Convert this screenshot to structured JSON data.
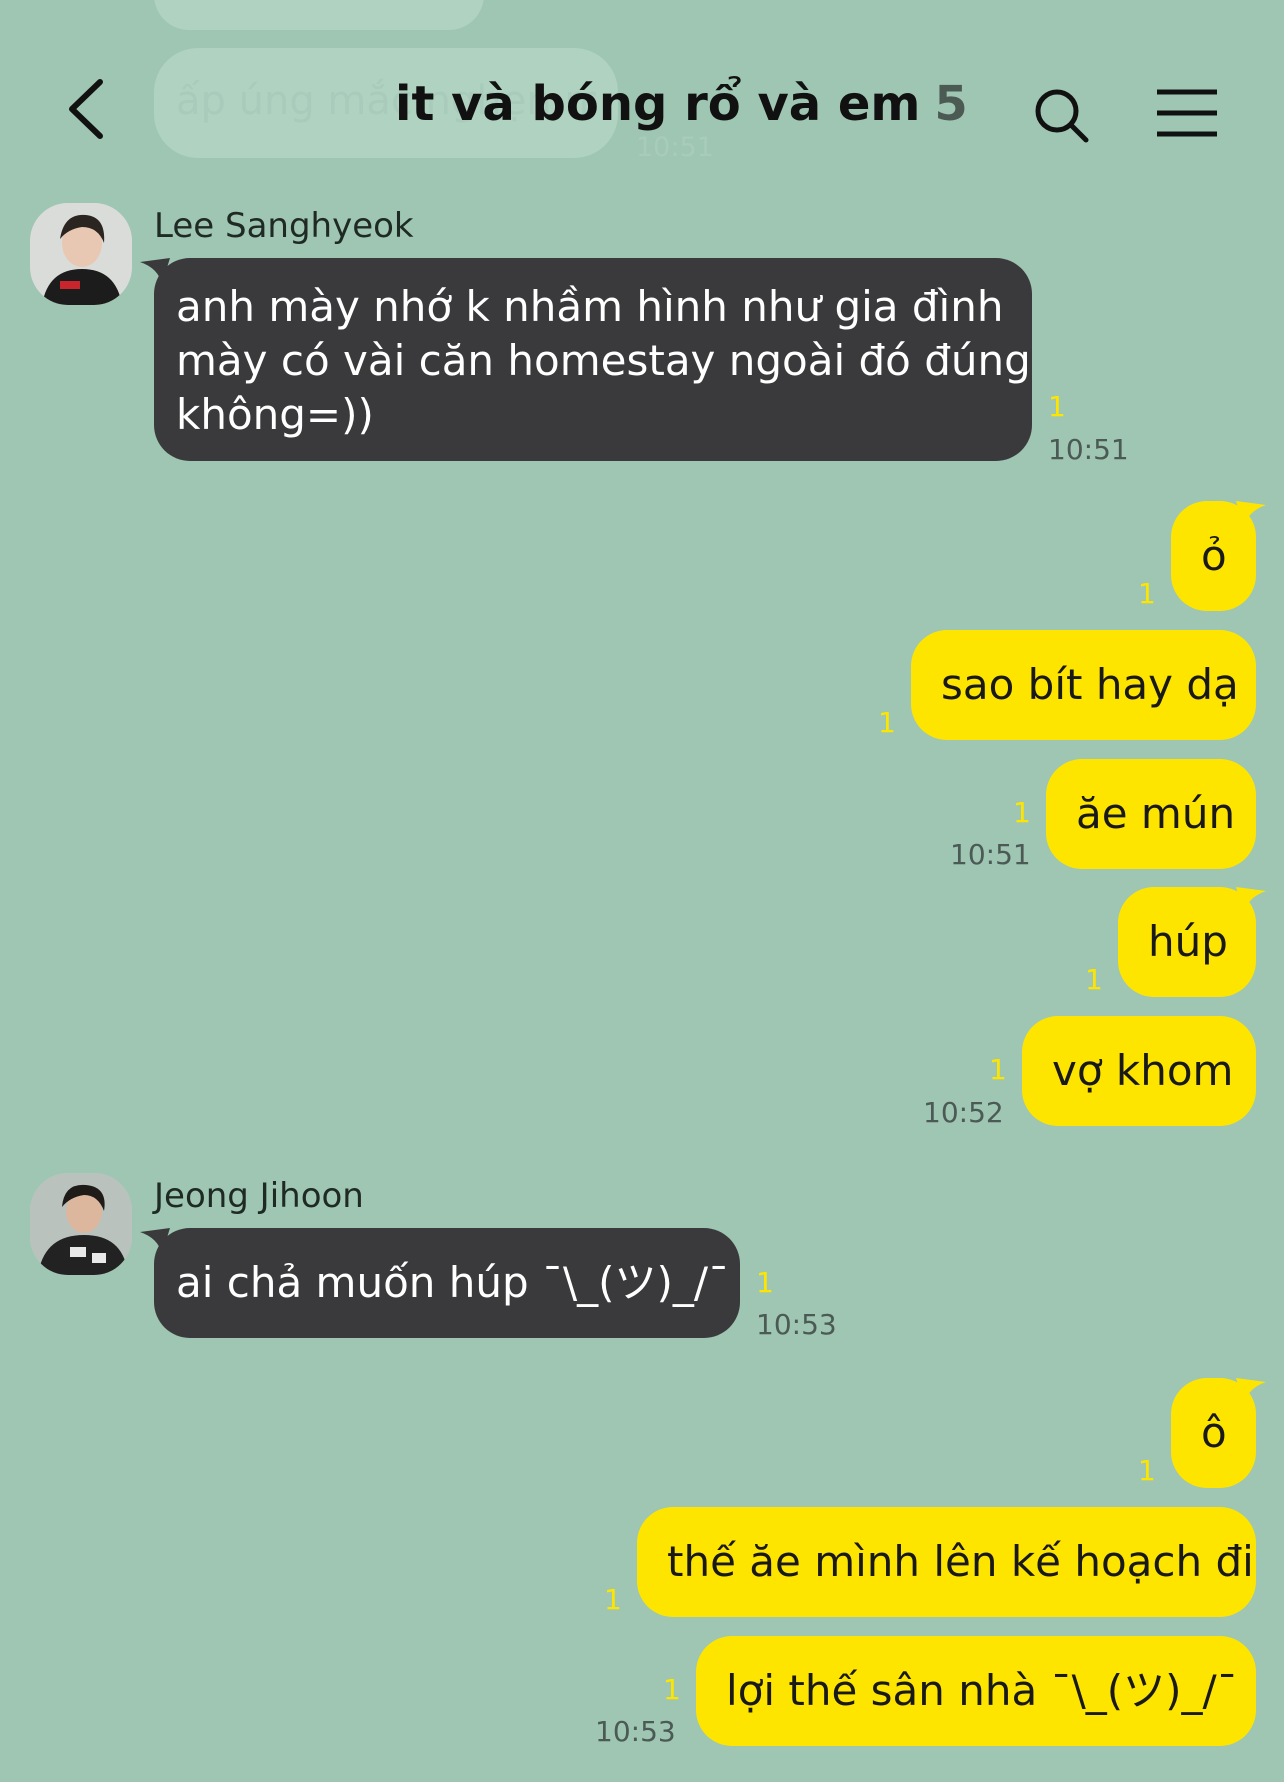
{
  "header": {
    "title": "it và bóng rổ và em",
    "member_count": "5"
  },
  "ghost": {
    "text": "ấp úng mắc nghẹn mãi...",
    "time": "10:51"
  },
  "colors": {
    "background": "#9ec6b3",
    "outgoing_bubble": "#fee500",
    "incoming_bubble": "#3a3a3c",
    "unread_count": "#fee500"
  },
  "messages": {
    "m1": {
      "sender": "Lee Sanghyeok",
      "lines": [
        "anh mày nhớ k nhầm hình như gia đình",
        "mày có vài căn homestay ngoài đó đúng",
        "không=))"
      ],
      "unread": "1",
      "time": "10:51"
    },
    "m2": {
      "text": "ỏ",
      "unread": "1"
    },
    "m3": {
      "text": "sao bít hay dạ",
      "unread": "1"
    },
    "m4": {
      "text": "ăe mún",
      "unread": "1",
      "time": "10:51"
    },
    "m5": {
      "text": "húp",
      "unread": "1"
    },
    "m6": {
      "text": "vợ khom",
      "unread": "1",
      "time": "10:52"
    },
    "m7": {
      "sender": "Jeong Jihoon",
      "text": "ai chả muốn húp ¯\\_(ツ)_/¯",
      "unread": "1",
      "time": "10:53"
    },
    "m8": {
      "text": "ô",
      "unread": "1"
    },
    "m9": {
      "text": "thế ăe mình lên kế hoạch đi",
      "unread": "1"
    },
    "m10": {
      "text": "lợi thế sân nhà ¯\\_(ツ)_/¯",
      "unread": "1",
      "time": "10:53"
    }
  }
}
